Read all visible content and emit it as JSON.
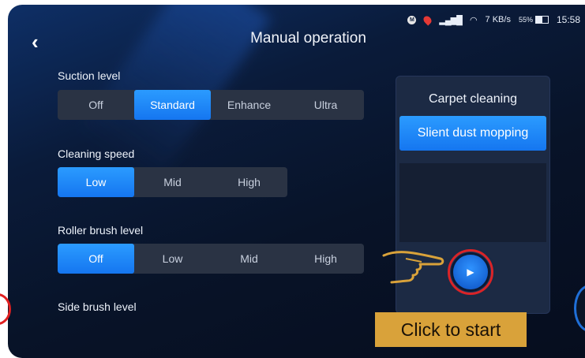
{
  "status_bar": {
    "m_icon": "M",
    "network_speed": "7 KB/s",
    "battery": "55%",
    "time": "15:58"
  },
  "header": {
    "back_icon": "‹",
    "title": "Manual operation"
  },
  "suction": {
    "label": "Suction level",
    "options": [
      "Off",
      "Standard",
      "Enhance",
      "Ultra"
    ],
    "selected": "Standard"
  },
  "speed": {
    "label": "Cleaning speed",
    "options": [
      "Low",
      "Mid",
      "High"
    ],
    "selected": "Low"
  },
  "roller": {
    "label": "Roller brush level",
    "options": [
      "Off",
      "Low",
      "Mid",
      "High"
    ],
    "selected": "Off"
  },
  "side_brush": {
    "label": "Side brush level"
  },
  "mode_panel": {
    "mode1": "Carpet cleaning",
    "mode2": "Slient dust mopping"
  },
  "start": {
    "icon": "play-icon",
    "cta": "Click to start"
  },
  "colors": {
    "accent": "#1e88ff",
    "highlight": "#e02020",
    "cta_bg": "#d9a23a"
  }
}
